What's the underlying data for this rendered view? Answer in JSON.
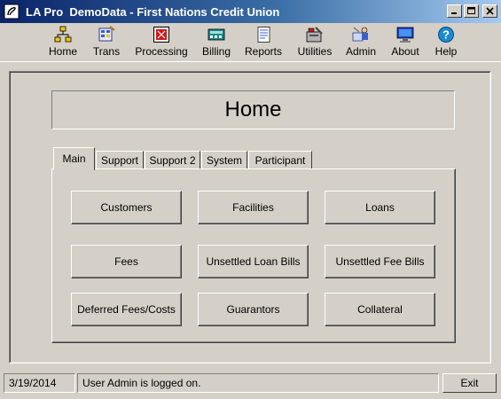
{
  "window": {
    "title": "LA Pro  DemoData - First Nations Credit Union"
  },
  "toolbar": {
    "items": [
      {
        "label": "Home",
        "icon": "home-icon"
      },
      {
        "label": "Trans",
        "icon": "transactions-icon"
      },
      {
        "label": "Processing",
        "icon": "processing-icon"
      },
      {
        "label": "Billing",
        "icon": "billing-icon"
      },
      {
        "label": "Reports",
        "icon": "reports-icon"
      },
      {
        "label": "Utilities",
        "icon": "utilities-icon"
      },
      {
        "label": "Admin",
        "icon": "admin-icon"
      },
      {
        "label": "About",
        "icon": "about-icon"
      },
      {
        "label": "Help",
        "icon": "help-icon"
      }
    ]
  },
  "page": {
    "title": "Home"
  },
  "tabs": [
    {
      "label": "Main",
      "active": true
    },
    {
      "label": "Support",
      "active": false
    },
    {
      "label": "Support 2",
      "active": false
    },
    {
      "label": "System",
      "active": false
    },
    {
      "label": "Participant",
      "active": false
    }
  ],
  "buttons": [
    {
      "label": "Customers"
    },
    {
      "label": "Facilities"
    },
    {
      "label": "Loans"
    },
    {
      "label": "Fees"
    },
    {
      "label": "Unsettled Loan Bills"
    },
    {
      "label": "Unsettled Fee Bills"
    },
    {
      "label": "Deferred Fees/Costs"
    },
    {
      "label": "Guarantors"
    },
    {
      "label": "Collateral"
    }
  ],
  "statusbar": {
    "date": "3/19/2014",
    "message": "User Admin is logged on.",
    "exit_label": "Exit"
  },
  "colors": {
    "face": "#d4d0c8",
    "titlebar_start": "#0a246a",
    "titlebar_end": "#a6caf0"
  }
}
